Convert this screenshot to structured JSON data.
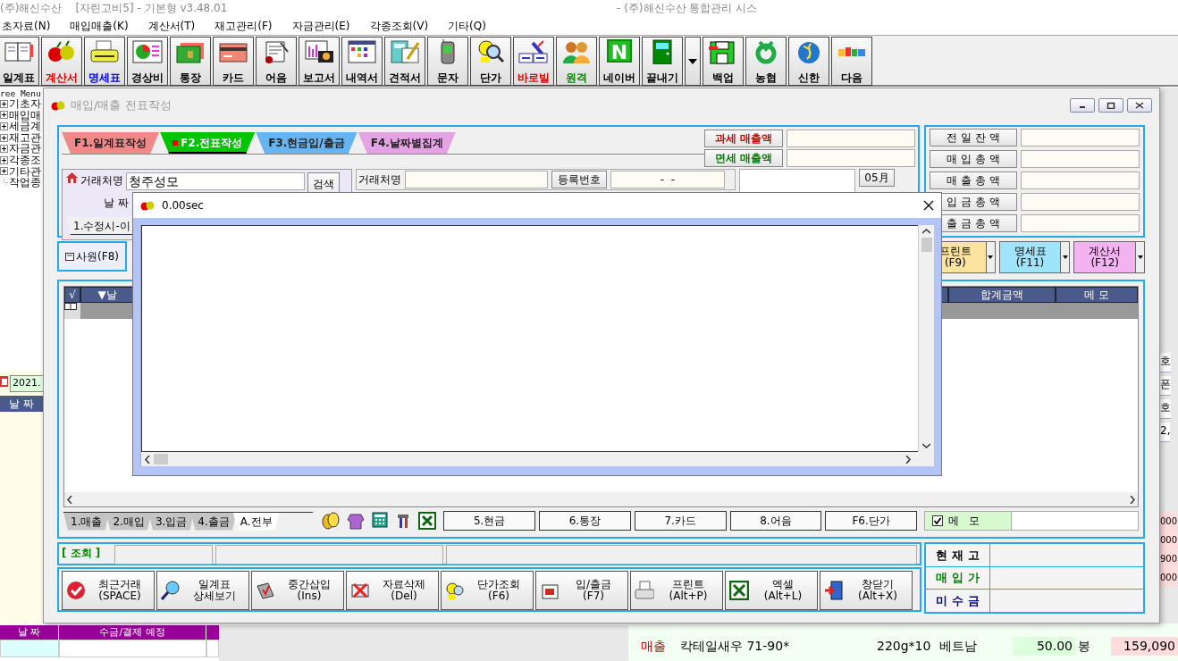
{
  "app": {
    "title": "(주)해신수산    [자린고비5] - 기본형 v3.48.01",
    "system_title": "- (주)해신수산 통합관리 시스"
  },
  "menu": [
    "초자료(N)",
    "매입매출(K)",
    "계산서(T)",
    "재고관리(F)",
    "자금관리(E)",
    "각종조회(V)",
    "기타(Q)"
  ],
  "toolbar": [
    {
      "kind": "button",
      "label": "일계표",
      "color": "#000000"
    },
    {
      "kind": "button",
      "label": "계산서",
      "color": "#dd0000"
    },
    {
      "kind": "button",
      "label": "명세표",
      "color": "#0000dd"
    },
    {
      "kind": "button",
      "label": "경상비",
      "color": "#000000"
    },
    {
      "kind": "button",
      "label": "통장",
      "color": "#000000"
    },
    {
      "kind": "button",
      "label": "카드",
      "color": "#000000"
    },
    {
      "kind": "button",
      "label": "어음",
      "color": "#000000"
    },
    {
      "kind": "button",
      "label": "보고서",
      "color": "#000000"
    },
    {
      "kind": "button",
      "label": "내역서",
      "color": "#000000"
    },
    {
      "kind": "button",
      "label": "견적서",
      "color": "#000000"
    },
    {
      "kind": "button",
      "label": "문자",
      "color": "#000000"
    },
    {
      "kind": "button",
      "label": "단가",
      "color": "#000000"
    },
    {
      "kind": "button",
      "label": "바로빌",
      "color": "#dd0000"
    },
    {
      "kind": "button",
      "label": "원격",
      "color": "#008800"
    },
    {
      "kind": "button",
      "label": "네이버",
      "color": "#000000",
      "glyph": "N"
    },
    {
      "kind": "button",
      "label": "끝내기",
      "color": "#000000"
    },
    {
      "kind": "dropdown"
    },
    {
      "kind": "button",
      "label": "백업",
      "color": "#000000"
    },
    {
      "kind": "button",
      "label": "농협",
      "color": "#000000"
    },
    {
      "kind": "button",
      "label": "신한",
      "color": "#000000"
    },
    {
      "kind": "button",
      "label": "다음",
      "color": "#000000"
    }
  ],
  "tree_menu": {
    "title": "ree Menu",
    "items": [
      {
        "label": "기초자",
        "kind": "folder"
      },
      {
        "label": "매입매",
        "kind": "folder"
      },
      {
        "label": "세금계",
        "kind": "folder"
      },
      {
        "label": "재고관",
        "kind": "folder"
      },
      {
        "label": "자금관",
        "kind": "folder"
      },
      {
        "label": "각종조",
        "kind": "folder"
      },
      {
        "label": "기타관",
        "kind": "folder"
      },
      {
        "label": "작업종",
        "kind": "leaf"
      }
    ]
  },
  "side_panel": {
    "date": "2021.",
    "header": "날 짜"
  },
  "schedule_table": {
    "columns": [
      "날 짜",
      "수금/결제 예정"
    ]
  },
  "right_panel": {
    "labels": [
      "호",
      "폰",
      "호",
      "2,"
    ],
    "amounts": [
      "000",
      "000",
      "900",
      "000"
    ],
    "row": [
      "매출",
      "칵테일새우 71-90*",
      "220g*10",
      "베트남",
      "50.00",
      "봉",
      "159,090"
    ]
  },
  "main_window": {
    "title": "매입/매출 전표작성",
    "tabs": [
      {
        "label": "F1.일계표작성",
        "color": "#f08a8a",
        "selected": false
      },
      {
        "label": "F2.전표작성",
        "color": "#00c400",
        "selected": true
      },
      {
        "label": "F3.현금입/출금",
        "color": "#66b4f0",
        "selected": false
      },
      {
        "label": "F4.날짜별집계",
        "color": "#e4a4e4",
        "selected": false
      }
    ],
    "sales_fields": [
      {
        "label": "과세 매출액",
        "color": "#cc0000"
      },
      {
        "label": "면세 매출액",
        "color": "#008000"
      }
    ],
    "totals": [
      "전 일 잔 액",
      "매 입 총 액",
      "매 출 총 액",
      "입 금 총 액",
      "출 금 총 액"
    ],
    "client": {
      "label": "거래처명",
      "value": "청주성모",
      "search": "검색",
      "date_label": "날 짜",
      "subtab": "1.수정시-이"
    },
    "client_info": {
      "label": "거래처명",
      "reg_label": "등록번호",
      "reg_value": "-  -",
      "month": "05月"
    },
    "staff_button": "사원(F8)",
    "print_buttons": [
      {
        "label": "프린트",
        "key": "(F9)",
        "color": "#fde3a0"
      },
      {
        "label": "명세표",
        "key": "(F11)",
        "color": "#9fe4fb"
      },
      {
        "label": "계산서",
        "key": "(F12)",
        "color": "#f3b3f0"
      }
    ],
    "grid_columns": [
      "√",
      "▼날",
      "합계금액",
      "메 모"
    ],
    "filter_tabs": [
      {
        "label": "1.매출",
        "selected": false
      },
      {
        "label": "2.매입",
        "selected": false
      },
      {
        "label": "3.입금",
        "selected": false
      },
      {
        "label": "4.출금",
        "selected": false
      },
      {
        "label": "A.전부",
        "selected": true
      }
    ],
    "type_buttons": [
      "5.현금",
      "6.통장",
      "7.카드",
      "8.어음",
      "F6.단가"
    ],
    "memo": {
      "label": "메   모",
      "checked": true
    },
    "query_label": "[ 조회 ]",
    "actions": [
      {
        "label": "최근거래",
        "sub": "(SPACE)"
      },
      {
        "label": "일계표",
        "sub": "상세보기"
      },
      {
        "label": "중간삽입",
        "sub": "(Ins)"
      },
      {
        "label": "자료삭제",
        "sub": "(Del)"
      },
      {
        "label": "단가조회",
        "sub": "(F6)"
      },
      {
        "label": "입/출금",
        "sub": "(F7)"
      },
      {
        "label": "프린트",
        "sub": "(Alt+P)"
      },
      {
        "label": "엑셀",
        "sub": "(Alt+L)"
      },
      {
        "label": "창닫기",
        "sub": "(Alt+X)"
      }
    ],
    "stock": [
      {
        "label": "현 재 고",
        "color": "#000000"
      },
      {
        "label": "매 입 가",
        "color": "#008000"
      },
      {
        "label": "미 수 금",
        "color": "#000080"
      }
    ]
  },
  "popup": {
    "title": "0.00sec"
  }
}
